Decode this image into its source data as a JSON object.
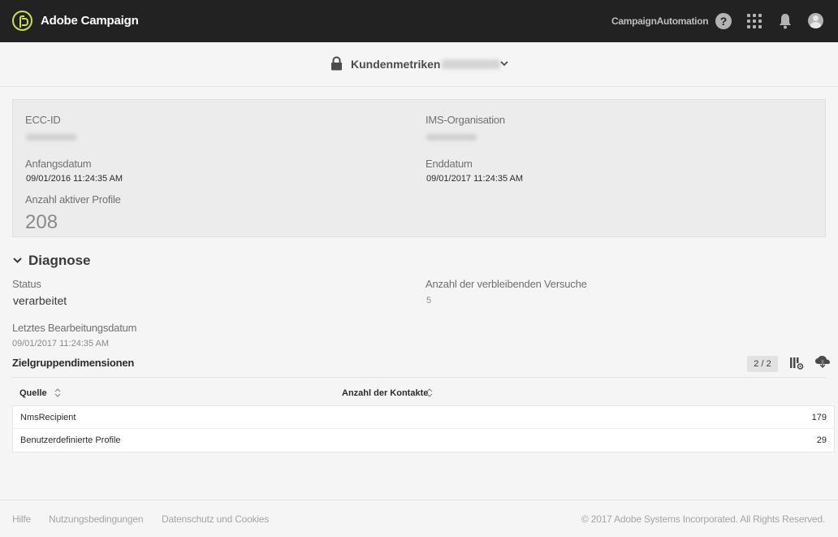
{
  "header": {
    "app_title": "Adobe Campaign",
    "org_name": "CampaignAutomation",
    "help_glyph": "?",
    "colors": {
      "bar": "#222222",
      "logo_accent": "#c8e14a"
    }
  },
  "titlebar": {
    "title": "Kundenmetriken"
  },
  "info": {
    "ecc_id_label": "ECC-ID",
    "ims_org_label": "IMS-Organisation",
    "start_date_label": "Anfangsdatum",
    "start_date_value": "09/01/2016 11:24:35 AM",
    "end_date_label": "Enddatum",
    "end_date_value": "09/01/2017 11:24:35 AM",
    "active_profiles_label": "Anzahl aktiver Profile",
    "active_profiles_value": "208"
  },
  "diagnose": {
    "title": "Diagnose",
    "status_label": "Status",
    "status_value": "verarbeitet",
    "retries_label": "Anzahl der verbleibenden Versuche",
    "retries_value": "5",
    "last_processed_label": "Letztes Bearbeitungsdatum",
    "last_processed_value": "09/01/2017 11:24:35 AM"
  },
  "dimensions": {
    "title": "Zielgruppendimensionen",
    "pager": "2 / 2",
    "columns": [
      "Quelle",
      "Anzahl der Kontakte"
    ],
    "rows": [
      {
        "source": "NmsRecipient",
        "count": "179"
      },
      {
        "source": "Benutzerdefinierte Profile",
        "count": "29"
      }
    ]
  },
  "footer": {
    "links": [
      "Hilfe",
      "Nutzungsbedingungen",
      "Datenschutz und Cookies"
    ],
    "copyright": "© 2017 Adobe Systems Incorporated. All Rights Reserved."
  }
}
